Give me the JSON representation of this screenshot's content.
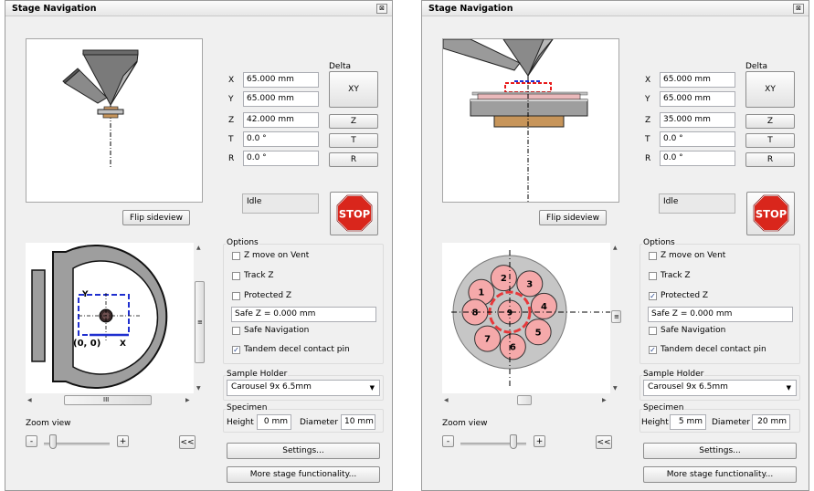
{
  "panels": [
    {
      "title": "Stage Navigation",
      "close_glyph": "⊠",
      "coords": [
        {
          "label": "X",
          "value": "65.000 mm"
        },
        {
          "label": "Y",
          "value": "65.000 mm"
        },
        {
          "label": "Z",
          "value": "42.000 mm"
        },
        {
          "label": "T",
          "value": "0.0 °"
        },
        {
          "label": "R",
          "value": "0.0 °"
        }
      ],
      "delta_label": "Delta",
      "delta_buttons": {
        "xy": "XY",
        "z": "Z",
        "t": "T",
        "r": "R"
      },
      "flip_label": "Flip sideview",
      "status": "Idle",
      "stop_label": "STOP",
      "options_title": "Options",
      "checks": {
        "z_vent": {
          "label": "Z move on Vent",
          "checked": false
        },
        "track_z": {
          "label": "Track Z",
          "checked": false
        },
        "protected_z": {
          "label": "Protected Z",
          "checked": false
        },
        "safe_nav": {
          "label": "Safe Navigation",
          "checked": false
        },
        "tandem": {
          "label": "Tandem decel contact pin",
          "checked": true
        }
      },
      "safe_z": "Safe Z =  0.000 mm",
      "holder_title": "Sample Holder",
      "holder_value": "Carousel 9x 6.5mm",
      "specimen_title": "Specimen",
      "height_label": "Height",
      "height_value": "0 mm",
      "diameter_label": "Diameter",
      "diameter_value": "10 mm",
      "zoom_label": "Zoom view",
      "zoom_level": 0.1,
      "minus_label": "-",
      "plus_label": "+",
      "collapse_label": "<<",
      "settings_label": "Settings...",
      "more_label": "More stage functionality...",
      "topview_text": {
        "y_axis": "Y",
        "origin": "(0, 0)",
        "x_axis": "X"
      },
      "hscroll_grip": "III",
      "vscroll_grip": "≡"
    },
    {
      "title": "Stage Navigation",
      "close_glyph": "⊠",
      "coords": [
        {
          "label": "X",
          "value": "65.000 mm"
        },
        {
          "label": "Y",
          "value": "65.000 mm"
        },
        {
          "label": "Z",
          "value": "35.000 mm"
        },
        {
          "label": "T",
          "value": "0.0 °"
        },
        {
          "label": "R",
          "value": "0.0 °"
        }
      ],
      "delta_label": "Delta",
      "delta_buttons": {
        "xy": "XY",
        "z": "Z",
        "t": "T",
        "r": "R"
      },
      "flip_label": "Flip sideview",
      "status": "Idle",
      "stop_label": "STOP",
      "options_title": "Options",
      "checks": {
        "z_vent": {
          "label": "Z move on Vent",
          "checked": false
        },
        "track_z": {
          "label": "Track Z",
          "checked": false
        },
        "protected_z": {
          "label": "Protected Z",
          "checked": true
        },
        "safe_nav": {
          "label": "Safe Navigation",
          "checked": false
        },
        "tandem": {
          "label": "Tandem decel contact pin",
          "checked": true
        }
      },
      "safe_z": "Safe Z =  0.000 mm",
      "holder_title": "Sample Holder",
      "holder_value": "Carousel 9x 6.5mm",
      "specimen_title": "Specimen",
      "height_label": "Height",
      "height_value": "5 mm",
      "diameter_label": "Diameter",
      "diameter_value": "20 mm",
      "zoom_label": "Zoom view",
      "zoom_level": 0.85,
      "minus_label": "-",
      "plus_label": "+",
      "collapse_label": "<<",
      "settings_label": "Settings...",
      "more_label": "More stage functionality...",
      "carousel_positions": [
        "1",
        "2",
        "3",
        "4",
        "5",
        "6",
        "7",
        "8",
        "9"
      ],
      "vscroll_grip": "≡"
    }
  ],
  "colors": {
    "stop_red": "#d9261c",
    "nav_box_blue": "#1f2fcf",
    "carousel_red": "#e8383a",
    "sample_pink": "#f5a9aa",
    "stage_gray": "#9e9e9e",
    "base_brown": "#c7955a"
  },
  "icons": [
    "close-icon",
    "stop-sign-icon",
    "chevron-down-icon",
    "checkmark-icon"
  ]
}
